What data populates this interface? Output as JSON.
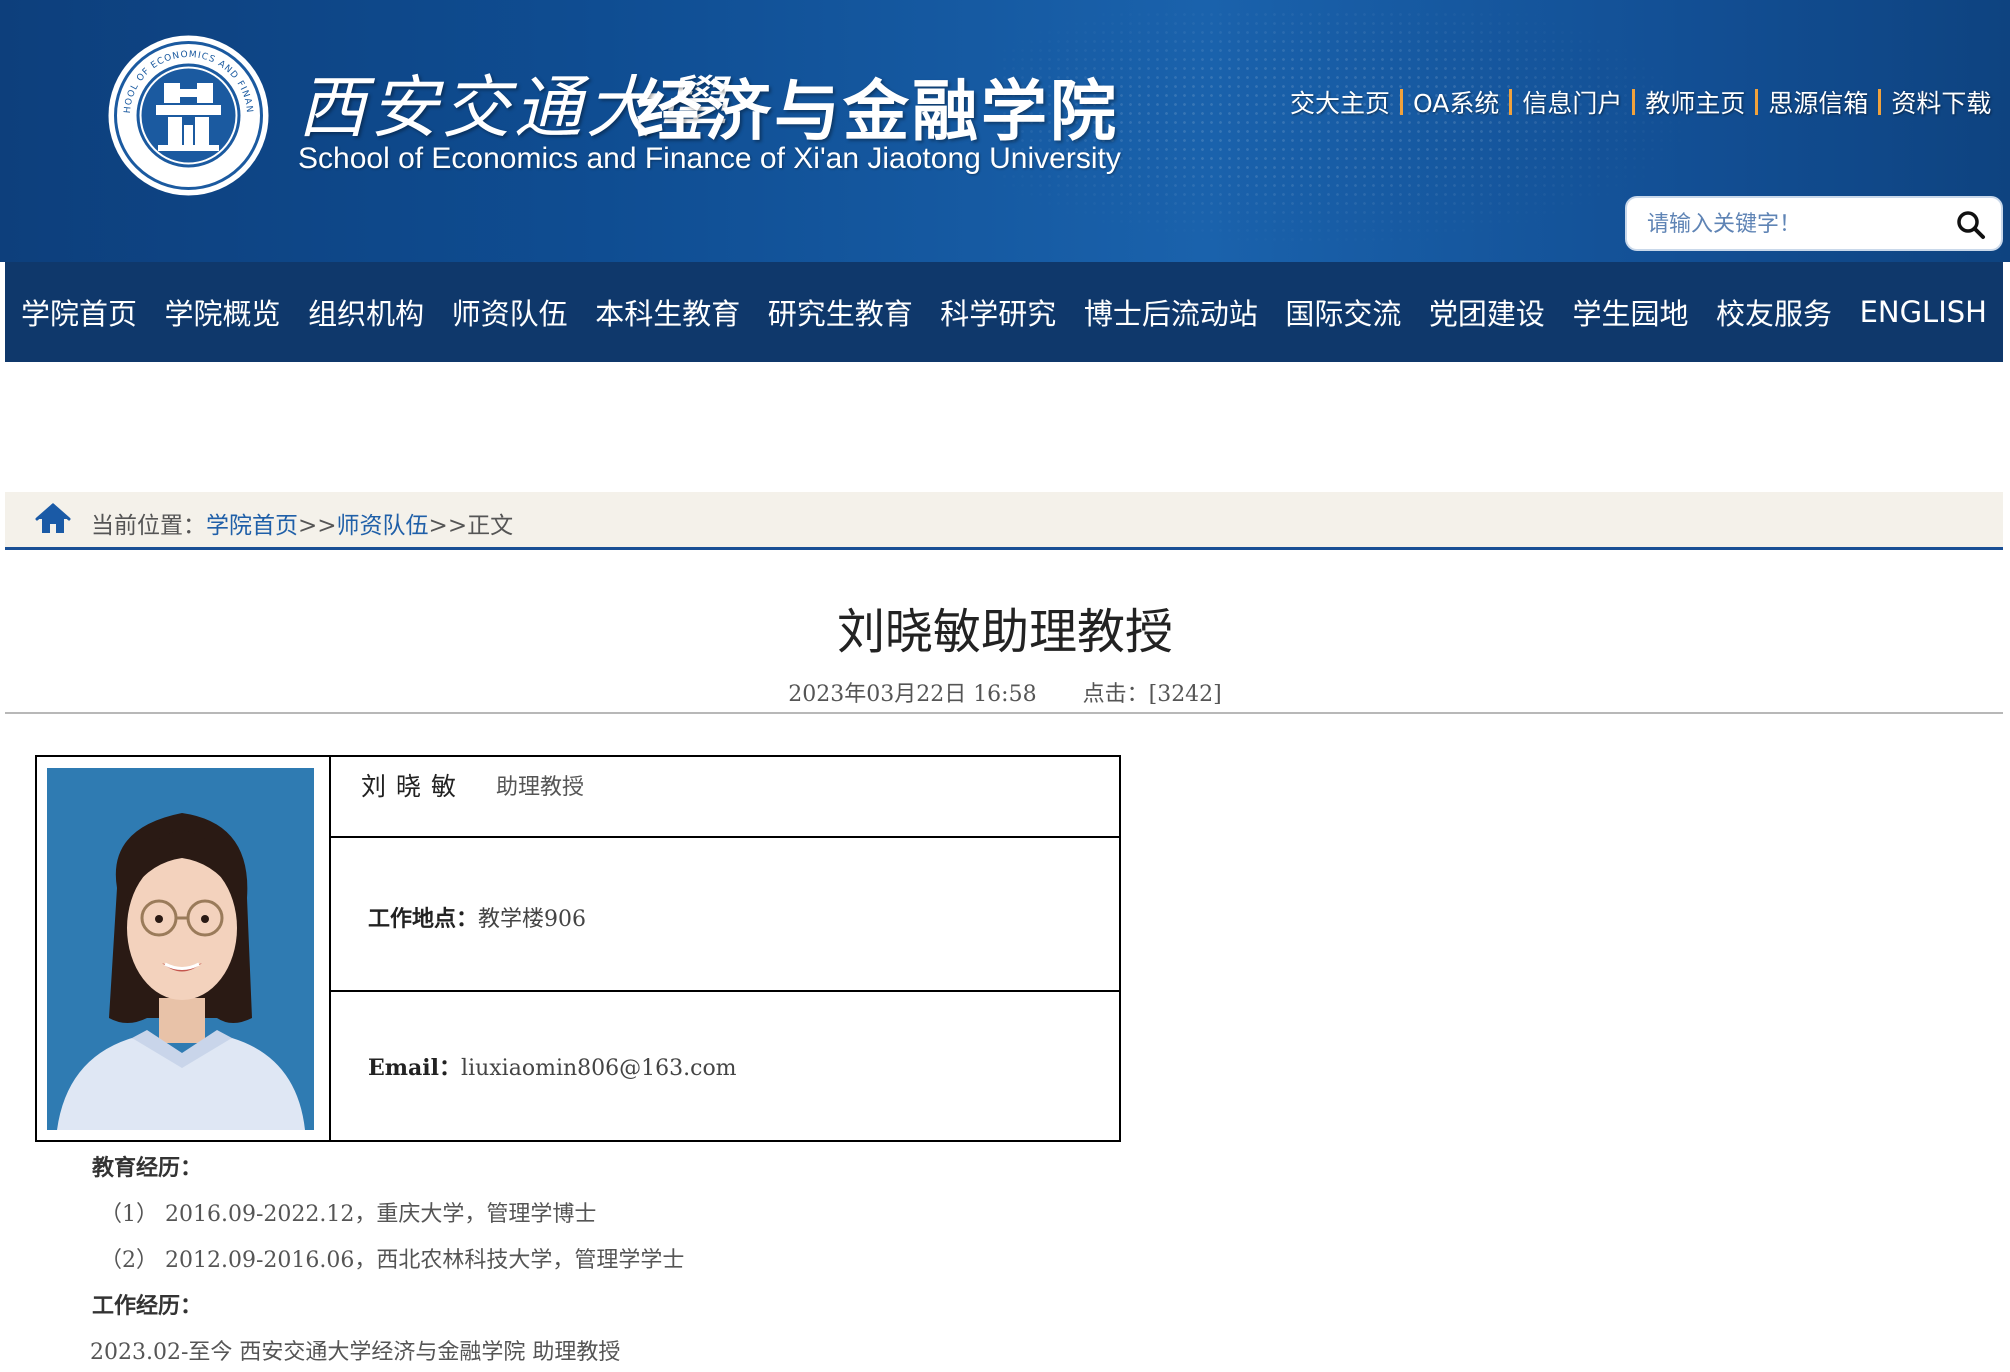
{
  "header": {
    "school_name_cn": "西安交通大學",
    "college_name_cn": "经济与金融学院",
    "college_name_en": "School of Economics and Finance of Xi'an Jiaotong University",
    "logo_text": "SCHOOL OF ECONOMICS AND FINANCE",
    "quick_links": [
      "交大主页",
      "OA系统",
      "信息门户",
      "教师主页",
      "思源信箱",
      "资料下载"
    ],
    "search_placeholder": "请输入关键字！"
  },
  "nav": {
    "items": [
      "学院首页",
      "学院概览",
      "组织机构",
      "师资队伍",
      "本科生教育",
      "研究生教育",
      "科学研究",
      "博士后流动站",
      "国际交流",
      "党团建设",
      "学生园地",
      "校友服务",
      "ENGLISH"
    ]
  },
  "breadcrumb": {
    "prefix": "当前位置：",
    "items": [
      "学院首页",
      "师资队伍",
      "正文"
    ],
    "separator": ">>"
  },
  "article": {
    "title": "刘晓敏助理教授",
    "date": "2023年03月22日  16:58",
    "clicks_label": "点击：",
    "clicks_value": "[3242]"
  },
  "profile": {
    "name": "刘晓敏",
    "rank": "助理教授",
    "location_label": "工作地点：",
    "location_value": "教学楼906",
    "email_label": "Email：",
    "email_value": "liuxiaomin806@163.com"
  },
  "education": {
    "heading": "教育经历：",
    "items": [
      "（1）  2016.09-2022.12，重庆大学，管理学博士",
      "（2）  2012.09-2016.06，西北农林科技大学，管理学学士"
    ]
  },
  "work": {
    "heading": "工作经历：",
    "items": [
      "2023.02-至今  西安交通大学经济与金融学院  助理教授"
    ]
  },
  "colors": {
    "header_blue": "#0f4d92",
    "nav_blue": "#0f386b",
    "crumb_bg": "#f4f1ea",
    "link_blue": "#1f5fa8",
    "separator_orange": "#f1a23c",
    "photo_bg": "#2f7bb2"
  },
  "icons": [
    "search-icon",
    "home-icon",
    "college-logo"
  ]
}
